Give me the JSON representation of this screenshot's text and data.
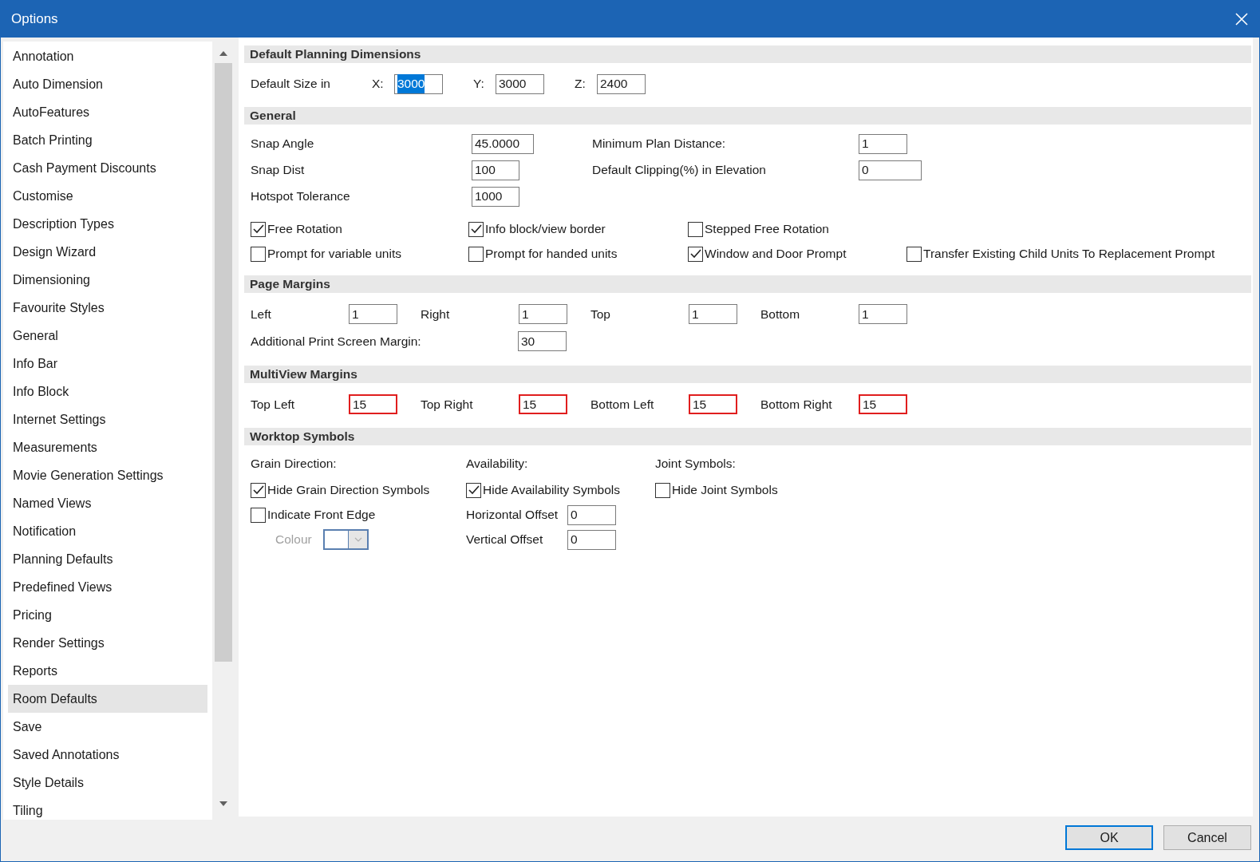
{
  "window": {
    "title": "Options"
  },
  "sidebar": {
    "items": [
      {
        "label": "Annotation",
        "selected": false
      },
      {
        "label": "Auto Dimension",
        "selected": false
      },
      {
        "label": "AutoFeatures",
        "selected": false
      },
      {
        "label": "Batch Printing",
        "selected": false
      },
      {
        "label": "Cash Payment Discounts",
        "selected": false
      },
      {
        "label": "Customise",
        "selected": false
      },
      {
        "label": "Description Types",
        "selected": false
      },
      {
        "label": "Design Wizard",
        "selected": false
      },
      {
        "label": "Dimensioning",
        "selected": false
      },
      {
        "label": "Favourite Styles",
        "selected": false
      },
      {
        "label": "General",
        "selected": false
      },
      {
        "label": "Info Bar",
        "selected": false
      },
      {
        "label": "Info Block",
        "selected": false
      },
      {
        "label": "Internet Settings",
        "selected": false
      },
      {
        "label": "Measurements",
        "selected": false
      },
      {
        "label": "Movie Generation Settings",
        "selected": false
      },
      {
        "label": "Named Views",
        "selected": false
      },
      {
        "label": "Notification",
        "selected": false
      },
      {
        "label": "Planning Defaults",
        "selected": false
      },
      {
        "label": "Predefined Views",
        "selected": false
      },
      {
        "label": "Pricing",
        "selected": false
      },
      {
        "label": "Render Settings",
        "selected": false
      },
      {
        "label": "Reports",
        "selected": false
      },
      {
        "label": "Room Defaults",
        "selected": true
      },
      {
        "label": "Save",
        "selected": false
      },
      {
        "label": "Saved Annotations",
        "selected": false
      },
      {
        "label": "Style Details",
        "selected": false
      },
      {
        "label": "Tiling",
        "selected": false
      }
    ]
  },
  "sections": [
    {
      "kind": "dimensions",
      "title": "Default Planning Dimensions",
      "label": "Default Size in",
      "fields": [
        {
          "label": "X:",
          "value": "3000",
          "text_selected": true
        },
        {
          "label": "Y:",
          "value": "3000",
          "text_selected": false
        },
        {
          "label": "Z:",
          "value": "2400",
          "text_selected": false
        }
      ]
    },
    {
      "kind": "general",
      "title": "General",
      "left_fields": [
        {
          "label": "Snap Angle",
          "value": "45.0000"
        },
        {
          "label": "Snap Dist",
          "value": "100"
        },
        {
          "label": "Hotspot Tolerance",
          "value": "1000"
        }
      ],
      "right_fields": [
        {
          "label": "Minimum Plan Distance:",
          "value": "1"
        },
        {
          "label": "Default Clipping(%) in Elevation",
          "value": "0"
        }
      ],
      "checkbox_rows": [
        [
          {
            "label": "Free Rotation",
            "checked": true
          },
          {
            "label": "Info block/view border",
            "checked": true
          },
          {
            "label": "Stepped Free Rotation",
            "checked": false
          }
        ],
        [
          {
            "label": "Prompt for variable units",
            "checked": false
          },
          {
            "label": "Prompt for handed units",
            "checked": false
          },
          {
            "label": "Window and Door Prompt",
            "checked": true
          },
          {
            "label": "Transfer Existing Child Units To Replacement Prompt",
            "checked": false
          }
        ]
      ]
    },
    {
      "kind": "grid",
      "title": "Page Margins",
      "rows": [
        [
          {
            "label": "Left",
            "value": "1",
            "highlighted": false
          },
          {
            "label": "Right",
            "value": "1",
            "highlighted": false
          },
          {
            "label": "Top",
            "value": "1",
            "highlighted": false
          },
          {
            "label": "Bottom",
            "value": "1",
            "highlighted": false
          }
        ],
        [
          {
            "label": "Additional Print Screen Margin:",
            "value": "30",
            "highlighted": false
          }
        ]
      ]
    },
    {
      "kind": "grid",
      "title": "MultiView Margins",
      "rows": [
        [
          {
            "label": "Top Left",
            "value": "15",
            "highlighted": true
          },
          {
            "label": "Top Right",
            "value": "15",
            "highlighted": true
          },
          {
            "label": "Bottom Left",
            "value": "15",
            "highlighted": true
          },
          {
            "label": "Bottom Right",
            "value": "15",
            "highlighted": true
          }
        ]
      ]
    },
    {
      "kind": "worktop",
      "title": "Worktop Symbols",
      "columns": [
        {
          "heading": "Grain Direction:",
          "items": [
            {
              "kind": "checkbox",
              "label": "Hide Grain Direction Symbols",
              "checked": true
            },
            {
              "kind": "checkbox",
              "label": "Indicate Front Edge",
              "checked": false
            },
            {
              "kind": "colour",
              "label": "Colour",
              "disabled": true
            }
          ]
        },
        {
          "heading": "Availability:",
          "items": [
            {
              "kind": "checkbox",
              "label": "Hide Availability Symbols",
              "checked": true
            },
            {
              "kind": "field",
              "label": "Horizontal Offset",
              "value": "0"
            },
            {
              "kind": "field",
              "label": "Vertical Offset",
              "value": "0"
            }
          ]
        },
        {
          "heading": "Joint Symbols:",
          "items": [
            {
              "kind": "checkbox",
              "label": "Hide Joint Symbols",
              "checked": false
            }
          ]
        }
      ]
    }
  ],
  "buttons": [
    {
      "label": "OK",
      "default": true
    },
    {
      "label": "Cancel",
      "default": false
    }
  ]
}
